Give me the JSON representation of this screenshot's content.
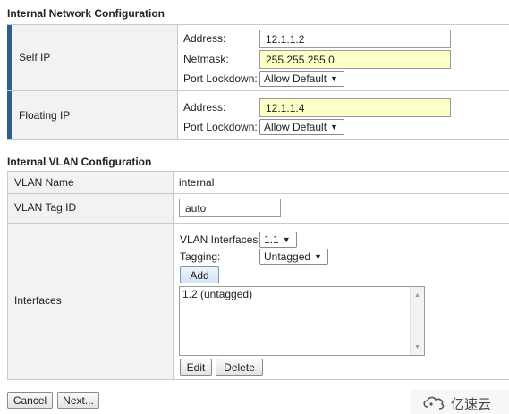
{
  "network": {
    "title": "Internal Network Configuration",
    "self_ip": {
      "label": "Self IP",
      "address_label": "Address:",
      "address_value": "12.1.1.2",
      "netmask_label": "Netmask:",
      "netmask_value": "255.255.255.0",
      "lockdown_label": "Port Lockdown:",
      "lockdown_value": "Allow Default"
    },
    "floating_ip": {
      "label": "Floating IP",
      "address_label": "Address:",
      "address_value": "12.1.1.4",
      "lockdown_label": "Port Lockdown:",
      "lockdown_value": "Allow Default"
    }
  },
  "vlan": {
    "title": "Internal VLAN Configuration",
    "name_label": "VLAN Name",
    "name_value": "internal",
    "tag_label": "VLAN Tag ID",
    "tag_value": "auto",
    "interfaces_label": "Interfaces",
    "vlan_interfaces_label": "VLAN Interfaces",
    "vlan_interfaces_value": "1.1",
    "tagging_label": "Tagging:",
    "tagging_value": "Untagged",
    "add_button": "Add",
    "interfaces_list": [
      "1.2 (untagged)"
    ],
    "edit_button": "Edit",
    "delete_button": "Delete"
  },
  "footer": {
    "cancel_button": "Cancel",
    "next_button": "Next..."
  },
  "watermark": {
    "text": "亿速云"
  }
}
